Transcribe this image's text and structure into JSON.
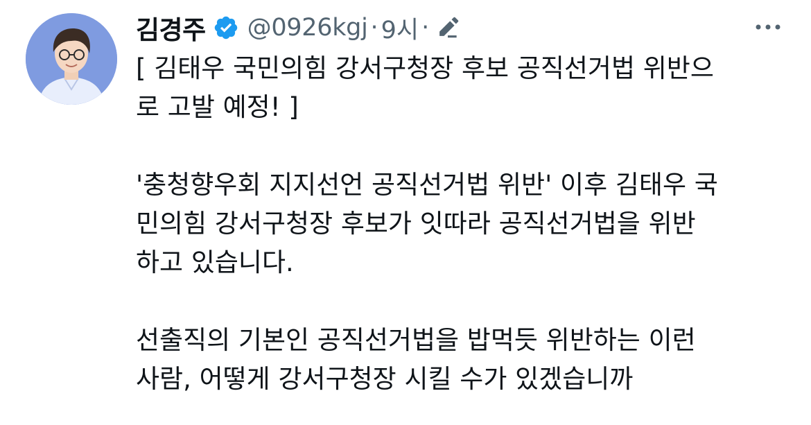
{
  "tweet": {
    "display_name": "김경주",
    "verified_icon": "verified-badge-icon",
    "handle": "@0926kgj",
    "separator": "·",
    "time": "9시",
    "separator_2": "·",
    "edit_icon": "edit-pencil-icon",
    "more_icon": "more-options-icon",
    "avatar": "profile-avatar",
    "colors": {
      "text": "#0f1419",
      "secondary": "#536471",
      "verified": "#1d9bf0",
      "avatar_bg": "#7f9be0"
    },
    "paragraphs": [
      {
        "lines": [
          "[ 김태우 국민의힘 강서구청장 후보 공직선거법 위반으",
          "로 고발 예정! ]"
        ]
      },
      {
        "lines": [
          "'충청향우회 지지선언 공직선거법 위반' 이후 김태우 국",
          "민의힘 강서구청장 후보가 잇따라 공직선거법을 위반",
          "하고 있습니다."
        ]
      },
      {
        "lines": [
          "선출직의 기본인 공직선거법을 밥먹듯 위반하는 이런",
          "사람, 어떻게 강서구청장 시킬 수가 있겠습니까"
        ]
      }
    ]
  }
}
